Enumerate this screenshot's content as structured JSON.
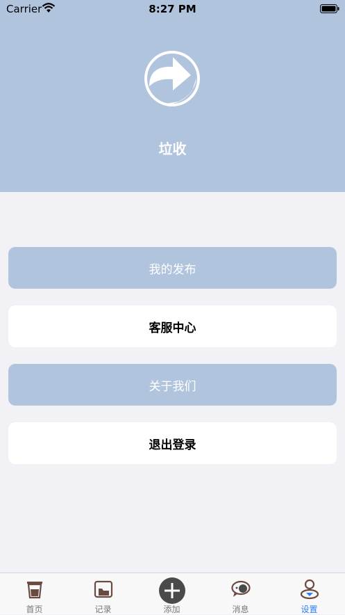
{
  "status": {
    "carrier": "Carrier",
    "time": "8:27 PM"
  },
  "header": {
    "title": "垃收",
    "logo_icon": "recycle-arrow-icon"
  },
  "menu": [
    {
      "label": "我的发布",
      "style": "blue"
    },
    {
      "label": "客服中心",
      "style": "white"
    },
    {
      "label": "关于我们",
      "style": "blue"
    },
    {
      "label": "退出登录",
      "style": "white"
    }
  ],
  "tabs": [
    {
      "label": "首页",
      "icon": "trash-can-icon"
    },
    {
      "label": "记录",
      "icon": "folder-icon"
    },
    {
      "label": "添加",
      "icon": "plus-circle-icon"
    },
    {
      "label": "消息",
      "icon": "chat-bubble-icon"
    },
    {
      "label": "设置",
      "icon": "user-icon",
      "active": true
    }
  ],
  "colors": {
    "accent": "#b1c4de",
    "active_tab": "#2f7df6",
    "background": "#f2f1f6"
  }
}
